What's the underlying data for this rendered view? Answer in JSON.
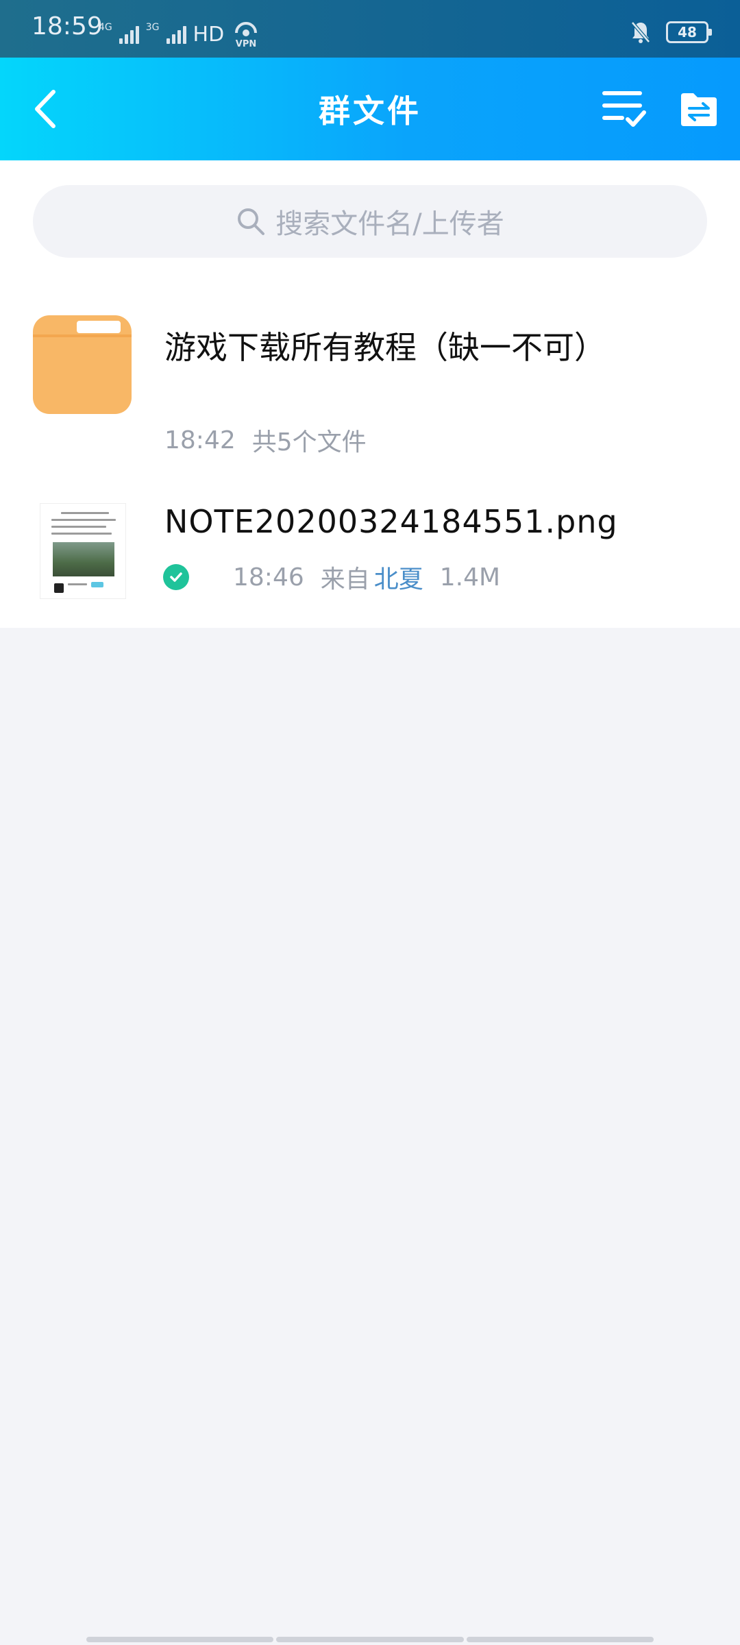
{
  "status_bar": {
    "time": "18:59",
    "network_1": "4G",
    "network_2": "3G",
    "hd": "HD",
    "vpn": "VPN",
    "battery": "48"
  },
  "nav": {
    "title": "群文件",
    "back_icon": "chevron-left-icon",
    "select_icon": "multi-select-icon",
    "folder_icon": "folder-transfer-icon"
  },
  "search": {
    "placeholder": "搜索文件名/上传者",
    "icon": "search-icon"
  },
  "files": [
    {
      "name": "游戏下载所有教程（缺一不可）",
      "time": "18:42",
      "detail": "共5个文件",
      "type": "folder"
    },
    {
      "name": "NOTE20200324184551.png",
      "time": "18:46",
      "from_label": "来自",
      "uploader": "北夏",
      "size": "1.4M",
      "type": "image",
      "status": "downloaded"
    }
  ],
  "colors": {
    "nav_gradient_start": "#04d6fb",
    "nav_gradient_end": "#069afd",
    "folder": "#f8b766",
    "check": "#1fc39a",
    "link": "#4a8ec9",
    "background": "#f3f4f8"
  }
}
